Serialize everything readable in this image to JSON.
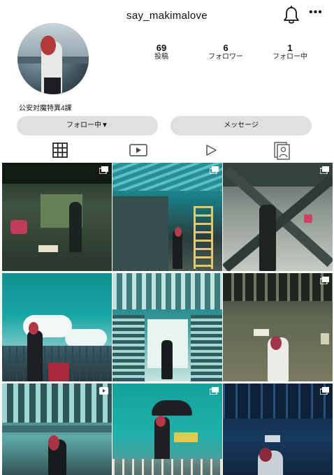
{
  "header": {
    "username": "say_makimalove",
    "bell_icon": "bell-icon",
    "more_icon": "more-options-icon",
    "more_glyph": "•••"
  },
  "profile": {
    "avatar_icon": "avatar",
    "bio": "公安対魔特異4課",
    "stats": {
      "posts": {
        "value": "69",
        "label": "投稿"
      },
      "followers": {
        "value": "6",
        "label": "フォロワー"
      },
      "following": {
        "value": "1",
        "label": "フォロー中"
      }
    }
  },
  "actions": {
    "follow_label": "フォロー中▼",
    "message_label": "メッセージ"
  },
  "tabs": [
    {
      "name": "grid",
      "icon": "grid-icon",
      "active": true
    },
    {
      "name": "reels",
      "icon": "reels-icon",
      "active": false
    },
    {
      "name": "video",
      "icon": "play-icon",
      "active": false
    },
    {
      "name": "tagged",
      "icon": "tagged-icon",
      "active": false
    }
  ],
  "posts": [
    {
      "id": 1,
      "badge": "carousel-icon",
      "palette": [
        "#2a3a2e",
        "#4d6b52",
        "#b9c9a0"
      ]
    },
    {
      "id": 2,
      "badge": "carousel-icon",
      "palette": [
        "#1c7f86",
        "#3fb5b6",
        "#d1c78a"
      ]
    },
    {
      "id": 3,
      "badge": "carousel-icon",
      "palette": [
        "#6e7d7a",
        "#2c3d3c",
        "#c9cfc4"
      ]
    },
    {
      "id": 4,
      "badge": "none",
      "palette": [
        "#16a3a3",
        "#e9f4f4",
        "#274b56"
      ]
    },
    {
      "id": 5,
      "badge": "none",
      "palette": [
        "#1e7478",
        "#bfe3e0",
        "#1a2b30"
      ]
    },
    {
      "id": 6,
      "badge": "carousel-icon",
      "palette": [
        "#4a5b4a",
        "#8b8a6c",
        "#2c332c"
      ]
    },
    {
      "id": 7,
      "badge": "reel-icon",
      "palette": [
        "#264a50",
        "#6fb8b5",
        "#1c2a2e"
      ]
    },
    {
      "id": 8,
      "badge": "carousel-icon",
      "palette": [
        "#1aa3a0",
        "#2d2d2d",
        "#e8d16d"
      ]
    },
    {
      "id": 9,
      "badge": "carousel-icon",
      "palette": [
        "#0f2c4a",
        "#3a5e86",
        "#cfd8e0"
      ]
    }
  ]
}
